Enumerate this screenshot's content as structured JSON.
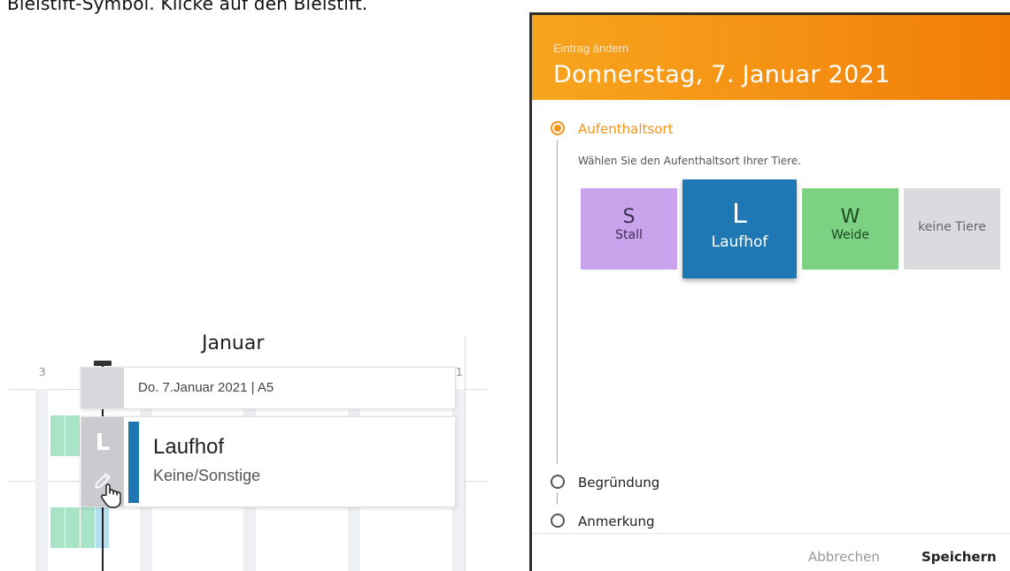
{
  "instruction": "Bleistift-Symbol. Klicke auf den Bleistift.",
  "calendar": {
    "month": "Januar",
    "day_start": "3",
    "day_end": "1"
  },
  "tooltip": {
    "header": "Do. 7.Januar 2021 | A5",
    "letter": "L",
    "title": "Laufhof",
    "subtitle": "Keine/Sonstige",
    "accent_color": "#1f78b4",
    "edit_icon": "pencil-icon"
  },
  "dialog": {
    "overline": "Eintrag ändern",
    "title": "Donnerstag, 7. Januar 2021",
    "header_color": "#f48e12",
    "steps": [
      {
        "label": "Aufenthaltsort",
        "active": true
      },
      {
        "label": "Begründung",
        "active": false
      },
      {
        "label": "Anmerkung",
        "active": false
      }
    ],
    "step_description": "Wählen Sie den Aufenthaltsort Ihrer Tiere.",
    "options": [
      {
        "letter": "S",
        "name": "Stall",
        "color": "#c9a4ec"
      },
      {
        "letter": "L",
        "name": "Laufhof",
        "color": "#1f78b4",
        "selected": true
      },
      {
        "letter": "W",
        "name": "Weide",
        "color": "#7cd183"
      },
      {
        "letter": "",
        "name": "keine Tiere",
        "color": "#d9dbde"
      }
    ],
    "cancel_label": "Abbrechen",
    "save_label": "Speichern"
  }
}
